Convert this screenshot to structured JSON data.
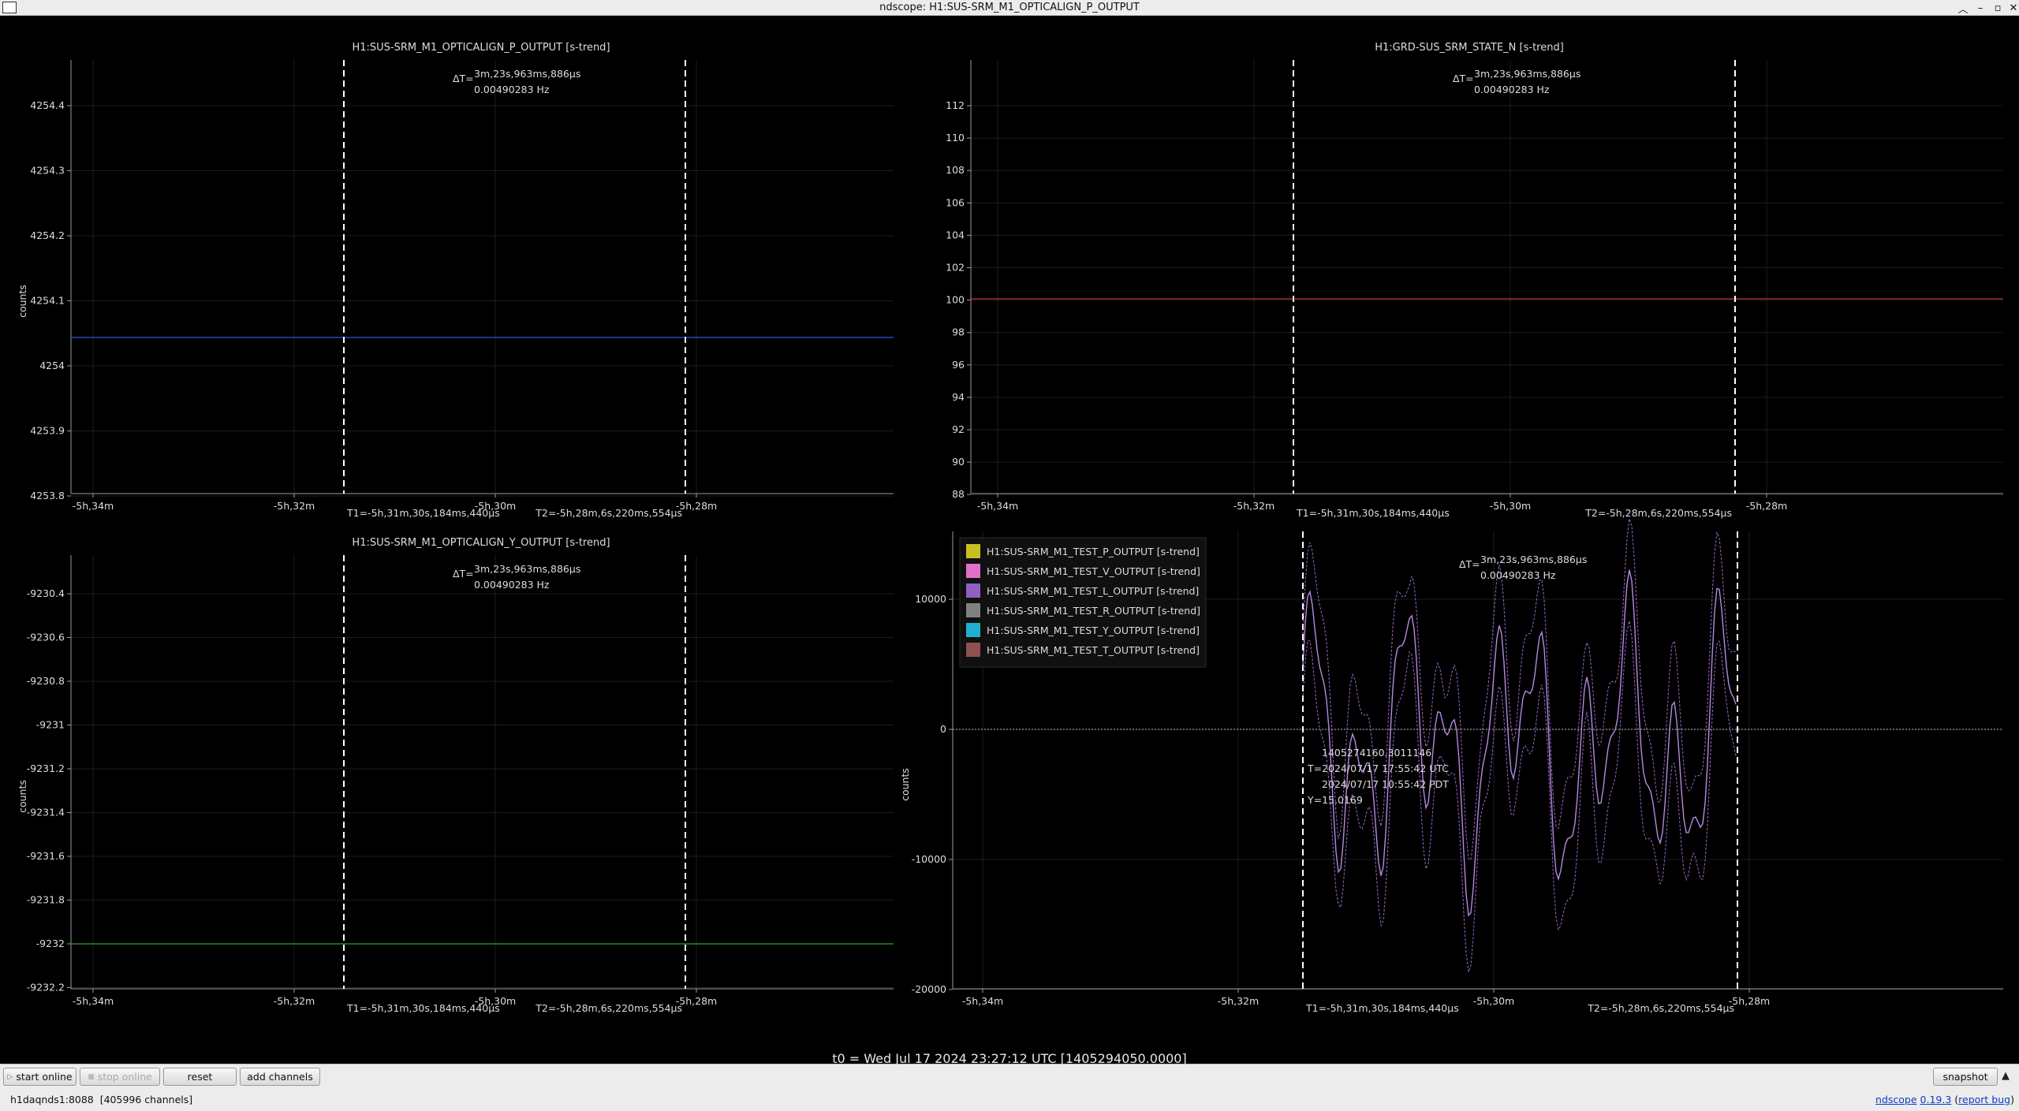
{
  "window": {
    "title": "ndscope: H1:SUS-SRM_M1_OPTICALIGN_P_OUTPUT"
  },
  "colors": {
    "pitch": "#3355dd",
    "state": "#c23030",
    "yaw": "#2fa030",
    "cursor": "#ffffff",
    "grid": "#2a2a2a",
    "axis": "#9a9a9a",
    "text": "#dddddd"
  },
  "plots": [
    {
      "title": "H1:SUS-SRM_M1_OPTICALIGN_P_OUTPUT [s-trend]",
      "ylabel": "counts",
      "delta_label": "ΔT=",
      "delta_time": "3m,23s,963ms,886µs",
      "delta_freq": "0.00490283 Hz",
      "t1_label": "T1=-5h,31m,30s,184ms,440µs",
      "t2_label": "T2=-5h,28m,6s,220ms,554µs",
      "x_ticks": [
        "-5h,34m",
        "-5h,32m",
        "-5h,30m",
        "-5h,28m"
      ],
      "y_ticks": [
        "4254.4",
        "4254.3",
        "4254.2",
        "4254.1",
        "4254",
        "4253.9",
        "4253.8"
      ],
      "series_value": "4254.04"
    },
    {
      "title": "H1:GRD-SUS_SRM_STATE_N [s-trend]",
      "ylabel": "",
      "delta_label": "ΔT=",
      "delta_time": "3m,23s,963ms,886µs",
      "delta_freq": "0.00490283 Hz",
      "t1_label": "T1=-5h,31m,30s,184ms,440µs",
      "t2_label": "T2=-5h,28m,6s,220ms,554µs",
      "x_ticks": [
        "-5h,34m",
        "-5h,32m",
        "-5h,30m",
        "-5h,28m"
      ],
      "y_ticks": [
        "112",
        "110",
        "108",
        "106",
        "104",
        "102",
        "100",
        "98",
        "96",
        "94",
        "92",
        "90",
        "88"
      ],
      "series_value": "100"
    },
    {
      "title": "H1:SUS-SRM_M1_OPTICALIGN_Y_OUTPUT [s-trend]",
      "ylabel": "counts",
      "delta_label": "ΔT=",
      "delta_time": "3m,23s,963ms,886µs",
      "delta_freq": "0.00490283 Hz",
      "t1_label": "T1=-5h,31m,30s,184ms,440µs",
      "t2_label": "T2=-5h,28m,6s,220ms,554µs",
      "x_ticks": [
        "-5h,34m",
        "-5h,32m",
        "-5h,30m",
        "-5h,28m"
      ],
      "y_ticks": [
        "-9230.4",
        "-9230.6",
        "-9230.8",
        "-9231",
        "-9231.2",
        "-9231.4",
        "-9231.6",
        "-9231.8",
        "-9232",
        "-9232.2"
      ],
      "series_value": "-9231.98"
    },
    {
      "title": "",
      "ylabel": "counts",
      "delta_label": "ΔT=",
      "delta_time": "3m,23s,963ms,886µs",
      "delta_freq": "0.00490283 Hz",
      "t1_label": "T1=-5h,31m,30s,184ms,440µs",
      "t2_label": "T2=-5h,28m,6s,220ms,554µs",
      "x_ticks": [
        "-5h,34m",
        "-5h,32m",
        "-5h,30m",
        "-5h,28m"
      ],
      "y_ticks": [
        "10000",
        "0",
        "-10000",
        "-20000"
      ],
      "legend": [
        {
          "label": "H1:SUS-SRM_M1_TEST_P_OUTPUT [s-trend]",
          "color": "#c8c020"
        },
        {
          "label": "H1:SUS-SRM_M1_TEST_V_OUTPUT [s-trend]",
          "color": "#e070c8"
        },
        {
          "label": "H1:SUS-SRM_M1_TEST_L_OUTPUT [s-trend]",
          "color": "#9060c0"
        },
        {
          "label": "H1:SUS-SRM_M1_TEST_R_OUTPUT [s-trend]",
          "color": "#808080"
        },
        {
          "label": "H1:SUS-SRM_M1_TEST_Y_OUTPUT [s-trend]",
          "color": "#20b0d0"
        },
        {
          "label": "H1:SUS-SRM_M1_TEST_T_OUTPUT [s-trend]",
          "color": "#905050"
        }
      ],
      "point_info": {
        "gps": "1405274160.3011146",
        "utc": "T=2024/07/17 17:55:42 UTC",
        "pdt": "2024/07/17 10:55:42 PDT",
        "y": "Y=15.0169"
      }
    }
  ],
  "t0": "t0 = Wed Jul 17 2024 23:27:12 UTC [1405294050.0000]",
  "toolbar": {
    "start_online": "start online",
    "stop_online": "stop online",
    "reset": "reset",
    "add_channels": "add channels",
    "snapshot": "snapshot"
  },
  "status": {
    "server": "h1daqnds1:8088",
    "channels": "[405996 channels]",
    "app": "ndscope",
    "version": "0.19.3",
    "report": "report bug"
  }
}
